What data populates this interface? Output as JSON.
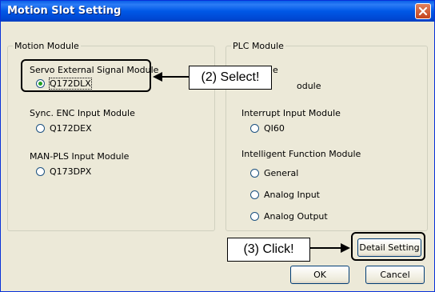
{
  "window": {
    "title": "Motion Slot Setting"
  },
  "motion_module": {
    "legend": "Motion Module",
    "groups": [
      {
        "label": "Servo External Signal Module",
        "options": [
          {
            "label": "Q172DLX",
            "selected": true
          }
        ]
      },
      {
        "label": "Sync. ENC Input Module",
        "options": [
          {
            "label": "Q172DEX",
            "selected": false
          }
        ]
      },
      {
        "label": "MAN-PLS Input Module",
        "options": [
          {
            "label": "Q173DPX",
            "selected": false
          }
        ]
      }
    ]
  },
  "plc_module": {
    "legend": "PLC Module",
    "partial_label_1": "e",
    "partial_label_2": "odule",
    "groups": [
      {
        "label": "Interrupt Input Module",
        "options": [
          {
            "label": "QI60",
            "selected": false
          }
        ]
      },
      {
        "label": "Intelligent Function Module",
        "options": [
          {
            "label": "General",
            "selected": false
          },
          {
            "label": "Analog Input",
            "selected": false
          },
          {
            "label": "Analog Output",
            "selected": false
          }
        ]
      }
    ]
  },
  "buttons": {
    "detail_setting": "Detail Setting",
    "ok": "OK",
    "cancel": "Cancel"
  },
  "annotations": {
    "select_callout": "(2) Select!",
    "click_callout": "(3) Click!"
  },
  "colors": {
    "titlebar": "#0058e6",
    "close_button": "#c4441d",
    "dialog_background": "#ece9d8",
    "radio_selected": "#21a121"
  },
  "icons": {
    "close": "close-icon"
  }
}
